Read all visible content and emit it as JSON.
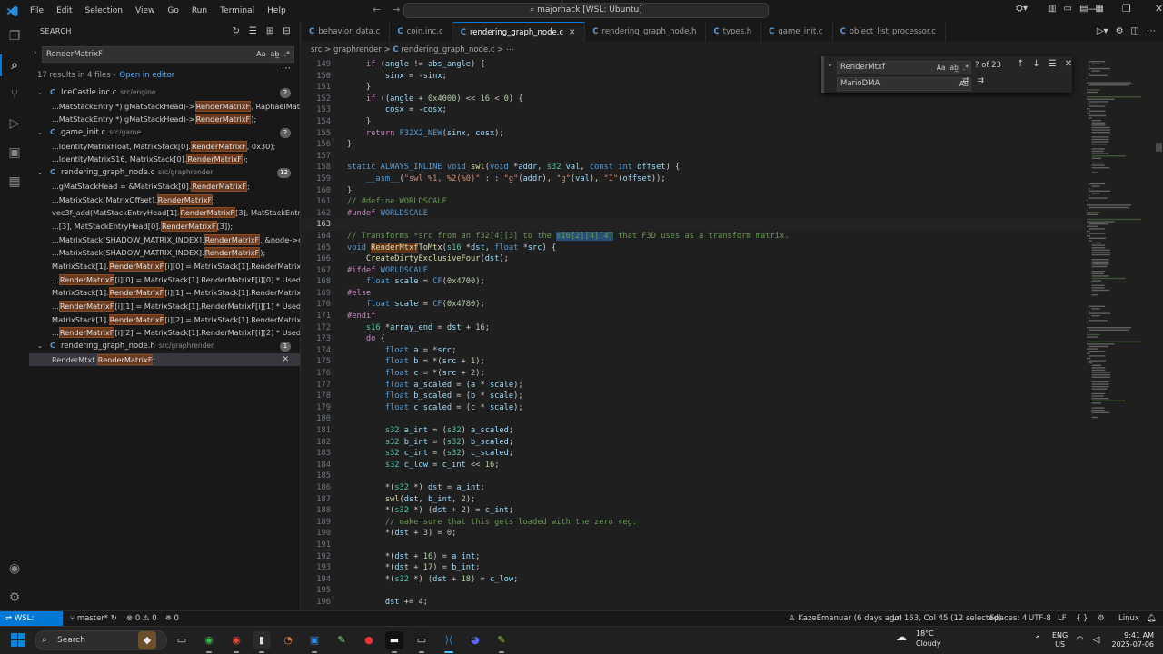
{
  "titlebar": {
    "menu": [
      "File",
      "Edit",
      "Selection",
      "View",
      "Go",
      "Run",
      "Terminal",
      "Help"
    ],
    "command_center": "majorhack [WSL: Ubuntu]"
  },
  "activity_bar": {
    "icons": [
      "explorer-icon",
      "search-icon",
      "source-control-icon",
      "run-debug-icon",
      "remote-explorer-icon",
      "extensions-icon",
      "account-icon",
      "settings-gear-icon"
    ],
    "active": "search-icon"
  },
  "search_panel": {
    "title": "SEARCH",
    "query": "RenderMatrixF",
    "summary": "17 results in 4 files -",
    "open_in_editor": "Open in editor",
    "files": [
      {
        "name": "IceCastle.inc.c",
        "path": "src/engine",
        "count": "2",
        "matches": [
          {
            "pre": "...MatStackEntry *) gMatStackHead)->",
            "hl": "RenderMatrixF",
            "post": ", RaphaelMatrix,"
          },
          {
            "pre": "...MatStackEntry *) gMatStackHead)->",
            "hl": "RenderMatrixF",
            "post": ");"
          }
        ]
      },
      {
        "name": "game_init.c",
        "path": "src/game",
        "count": "2",
        "matches": [
          {
            "pre": "...IdentityMatrixFloat, MatrixStack[0].",
            "hl": "RenderMatrixF",
            "post": ", 0x30);"
          },
          {
            "pre": "...IdentityMatrixS16, MatrixStack[0].",
            "hl": "RenderMatrixF",
            "post": ");"
          }
        ]
      },
      {
        "name": "rendering_graph_node.c",
        "path": "src/graphrender",
        "count": "12",
        "matches": [
          {
            "pre": "...gMatStackHead = &MatrixStack[0].",
            "hl": "RenderMatrixF",
            "post": ";"
          },
          {
            "pre": "...MatrixStack[MatrixOffset].",
            "hl": "RenderMatrixF",
            "post": ";"
          },
          {
            "pre": "vec3f_add(MatStackEntryHead[1].",
            "hl": "RenderMatrixF",
            "post": "[3], MatStackEntryHea..."
          },
          {
            "pre": "...[3], MatStackEntryHead[0].",
            "hl": "RenderMatrixF",
            "post": "[3]);"
          },
          {
            "pre": "...MatrixStack[SHADOW_MATRIX_INDEX].",
            "hl": "RenderMatrixF",
            "post": ", &node->oFl..."
          },
          {
            "pre": "...MatrixStack[SHADOW_MATRIX_INDEX].",
            "hl": "RenderMatrixF",
            "post": ");"
          },
          {
            "pre": "MatrixStack[1].",
            "hl": "RenderMatrixF",
            "post": "[i][0] = MatrixStack[1].RenderMatrixF[i][0..."
          },
          {
            "pre": "...",
            "hl": "RenderMatrixF",
            "post": "[i][0] = MatrixStack[1].RenderMatrixF[i][0] * UsedScale;"
          },
          {
            "pre": "MatrixStack[1].",
            "hl": "RenderMatrixF",
            "post": "[i][1] = MatrixStack[1].RenderMatrixF[i][1..."
          },
          {
            "pre": "...",
            "hl": "RenderMatrixF",
            "post": "[i][1] = MatrixStack[1].RenderMatrixF[i][1] * UsedScale;"
          },
          {
            "pre": "MatrixStack[1].",
            "hl": "RenderMatrixF",
            "post": "[i][2] = MatrixStack[1].RenderMatrixF[i][2..."
          },
          {
            "pre": "...",
            "hl": "RenderMatrixF",
            "post": "[i][2] = MatrixStack[1].RenderMatrixF[i][2] * UsedScale;"
          }
        ]
      },
      {
        "name": "rendering_graph_node.h",
        "path": "src/graphrender",
        "count": "1",
        "matches": [
          {
            "pre": "RenderMtxf ",
            "hl": "RenderMatrixF",
            "post": ";"
          }
        ]
      }
    ]
  },
  "tabs": [
    {
      "label": "behavior_data.c",
      "active": false
    },
    {
      "label": "coin.inc.c",
      "active": false
    },
    {
      "label": "rendering_graph_node.c",
      "active": true
    },
    {
      "label": "rendering_graph_node.h",
      "active": false
    },
    {
      "label": "types.h",
      "active": false
    },
    {
      "label": "game_init.c",
      "active": false
    },
    {
      "label": "object_list_processor.c",
      "active": false
    }
  ],
  "breadcrumb": {
    "folder1": "src",
    "folder2": "graphrender",
    "file": "rendering_graph_node.c"
  },
  "find_widget": {
    "find_value": "RenderMtxf",
    "count": "? of 23",
    "replace_value": "MarioDMA"
  },
  "code": {
    "current_line": 163,
    "lines": [
      {
        "n": 149,
        "t": "    if (angle != abs_angle) {"
      },
      {
        "n": 150,
        "t": "        sinx = -sinx;"
      },
      {
        "n": 151,
        "t": "    }"
      },
      {
        "n": 152,
        "t": "    if ((angle + 0x4000) << 16 < 0) {"
      },
      {
        "n": 153,
        "t": "        cosx = -cosx;"
      },
      {
        "n": 154,
        "t": "    }"
      },
      {
        "n": 155,
        "t": "    return F32X2_NEW(sinx, cosx);"
      },
      {
        "n": 156,
        "t": "}"
      },
      {
        "n": 157,
        "t": ""
      },
      {
        "n": 158,
        "t": "static ALWAYS_INLINE void swl(void *addr, s32 val, const int offset) {"
      },
      {
        "n": 159,
        "t": "    __asm__(\"swl %1, %2(%0)\" : : \"g\"(addr), \"g\"(val), \"I\"(offset));"
      },
      {
        "n": 160,
        "t": "}"
      },
      {
        "n": 161,
        "t": "// #define WORLDSCALE"
      },
      {
        "n": 162,
        "t": "#undef WORLDSCALE"
      },
      {
        "n": 163,
        "t": ""
      },
      {
        "n": 164,
        "t": "// Transforms *src from an f32[4][3] to the s16[2][4][4] that F3D uses as a transform matrix."
      },
      {
        "n": 165,
        "t": "void RenderMtxfToMtx(s16 *dst, float *src) {"
      },
      {
        "n": 166,
        "t": "    CreateDirtyExclusiveFour(dst);"
      },
      {
        "n": 167,
        "t": "#ifdef WORLDSCALE"
      },
      {
        "n": 168,
        "t": "    float scale = CF(0x4700);"
      },
      {
        "n": 169,
        "t": "#else"
      },
      {
        "n": 170,
        "t": "    float scale = CF(0x4780);"
      },
      {
        "n": 171,
        "t": "#endif"
      },
      {
        "n": 172,
        "t": "    s16 *array_end = dst + 16;"
      },
      {
        "n": 173,
        "t": "    do {"
      },
      {
        "n": 174,
        "t": "        float a = *src;"
      },
      {
        "n": 175,
        "t": "        float b = *(src + 1);"
      },
      {
        "n": 176,
        "t": "        float c = *(src + 2);"
      },
      {
        "n": 177,
        "t": "        float a_scaled = (a * scale);"
      },
      {
        "n": 178,
        "t": "        float b_scaled = (b * scale);"
      },
      {
        "n": 179,
        "t": "        float c_scaled = (c * scale);"
      },
      {
        "n": 180,
        "t": ""
      },
      {
        "n": 181,
        "t": "        s32 a_int = (s32) a_scaled;"
      },
      {
        "n": 182,
        "t": "        s32 b_int = (s32) b_scaled;"
      },
      {
        "n": 183,
        "t": "        s32 c_int = (s32) c_scaled;"
      },
      {
        "n": 184,
        "t": "        s32 c_low = c_int << 16;"
      },
      {
        "n": 185,
        "t": ""
      },
      {
        "n": 186,
        "t": "        *(s32 *) dst = a_int;"
      },
      {
        "n": 187,
        "t": "        swl(dst, b_int, 2);"
      },
      {
        "n": 188,
        "t": "        *(s32 *) (dst + 2) = c_int;"
      },
      {
        "n": 189,
        "t": "        // make sure that this gets loaded with the zero reg."
      },
      {
        "n": 190,
        "t": "        *(dst + 3) = 0;"
      },
      {
        "n": 191,
        "t": ""
      },
      {
        "n": 192,
        "t": "        *(dst + 16) = a_int;"
      },
      {
        "n": 193,
        "t": "        *(dst + 17) = b_int;"
      },
      {
        "n": 194,
        "t": "        *(s32 *) (dst + 18) = c_low;"
      },
      {
        "n": 195,
        "t": ""
      },
      {
        "n": 196,
        "t": "        dst += 4;"
      }
    ]
  },
  "statusbar": {
    "remote": "WSL: Ubuntu",
    "branch": "master*",
    "problems": "⊗ 0 ⚠ 0",
    "ports": "0",
    "blame": "KazeEmanuar (6 days ago)",
    "position": "Ln 163, Col 45 (12 selected)",
    "spaces": "Spaces: 4",
    "encoding": "UTF-8",
    "eol": "LF",
    "lang": "Linux"
  },
  "taskbar": {
    "search": "Search",
    "temp": "18°C",
    "weather": "Cloudy",
    "lang1": "ENG",
    "lang2": "US",
    "time": "9:41 AM",
    "date": "2025-07-06"
  }
}
